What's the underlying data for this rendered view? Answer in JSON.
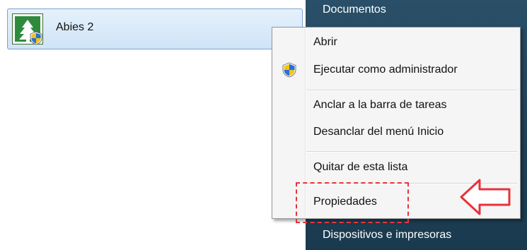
{
  "pinned_program": {
    "name": "Abies 2",
    "icon": "abies-tree-icon"
  },
  "start_right_panel": {
    "items": [
      {
        "label": "Documentos"
      },
      {
        "label": "Dispositivos e impresoras"
      }
    ]
  },
  "context_menu": {
    "items": [
      {
        "label": "Abrir"
      },
      {
        "label": "Ejecutar como administrador",
        "icon": "uac-shield-icon"
      },
      {
        "label": "Anclar a la barra de tareas"
      },
      {
        "label": "Desanclar del menú Inicio"
      },
      {
        "label": "Quitar de esta lista"
      },
      {
        "label": "Propiedades"
      }
    ]
  },
  "annotation": {
    "highlight_color": "#e8323a",
    "arrow_icon": "left-arrow-outline"
  }
}
